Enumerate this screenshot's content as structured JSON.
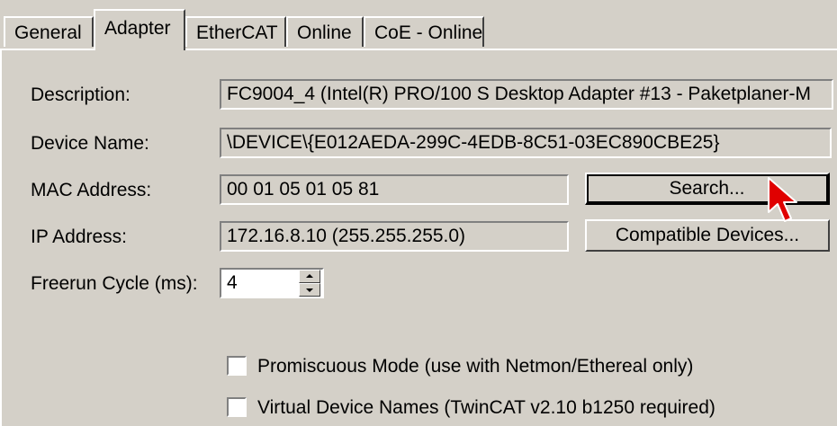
{
  "tabs": [
    {
      "label": "General"
    },
    {
      "label": "Adapter"
    },
    {
      "label": "EtherCAT"
    },
    {
      "label": "Online"
    },
    {
      "label": "CoE - Online"
    }
  ],
  "active_tab": "Adapter",
  "fields": {
    "description": {
      "label": "Description:",
      "value": "FC9004_4 (Intel(R) PRO/100 S Desktop Adapter #13 - Paketplaner-M"
    },
    "device_name": {
      "label": "Device Name:",
      "value": "\\DEVICE\\{E012AEDA-299C-4EDB-8C51-03EC890CBE25}"
    },
    "mac_address": {
      "label": "MAC Address:",
      "value": "00 01 05 01 05 81"
    },
    "ip_address": {
      "label": "IP Address:",
      "value": "172.16.8.10 (255.255.255.0)"
    },
    "freerun_cycle": {
      "label": "Freerun Cycle (ms):",
      "value": "4"
    }
  },
  "buttons": {
    "search": "Search...",
    "compatible_devices": "Compatible Devices..."
  },
  "checkboxes": {
    "promiscuous": {
      "label": "Promiscuous Mode (use with Netmon/Ethereal only)",
      "checked": false
    },
    "virtual_names": {
      "label": "Virtual Device Names (TwinCAT v2.10 b1250 required)",
      "checked": false
    }
  },
  "colors": {
    "face": "#d4d0c8",
    "cursor": "#e00000"
  },
  "icons": {
    "cursor": "mouse-pointer-icon"
  }
}
